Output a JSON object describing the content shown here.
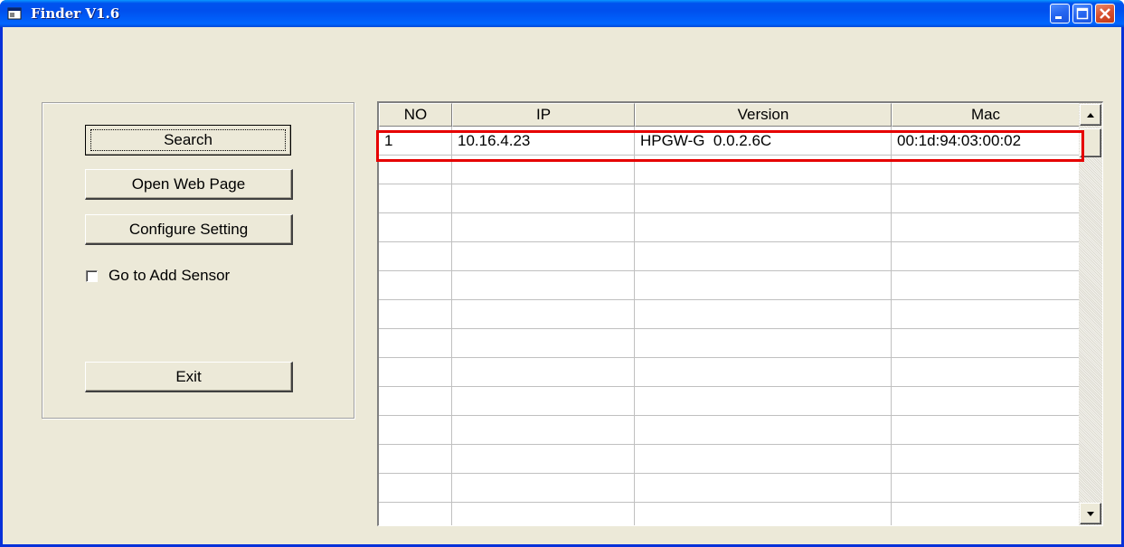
{
  "window": {
    "title": "Finder V1.6"
  },
  "left_panel": {
    "search_label": "Search",
    "open_web_label": "Open Web Page",
    "configure_label": "Configure Setting",
    "checkbox_label": "Go to Add Sensor",
    "checkbox_checked": false,
    "exit_label": "Exit"
  },
  "table": {
    "columns": [
      "NO",
      "IP",
      "Version",
      "Mac"
    ],
    "rows": [
      [
        "1",
        "10.16.4.23",
        "HPGW-G  0.0.2.6C",
        "00:1d:94:03:00:02"
      ],
      [
        "",
        "",
        "",
        ""
      ],
      [
        "",
        "",
        "",
        ""
      ],
      [
        "",
        "",
        "",
        ""
      ],
      [
        "",
        "",
        "",
        ""
      ],
      [
        "",
        "",
        "",
        ""
      ],
      [
        "",
        "",
        "",
        ""
      ],
      [
        "",
        "",
        "",
        ""
      ],
      [
        "",
        "",
        "",
        ""
      ],
      [
        "",
        "",
        "",
        ""
      ],
      [
        "",
        "",
        "",
        ""
      ],
      [
        "",
        "",
        "",
        ""
      ],
      [
        "",
        "",
        "",
        ""
      ],
      [
        "",
        "",
        "",
        ""
      ]
    ]
  },
  "colors": {
    "highlight": "#e60000",
    "titlebar": "#0053ee",
    "window_bg": "#ece9d8"
  }
}
